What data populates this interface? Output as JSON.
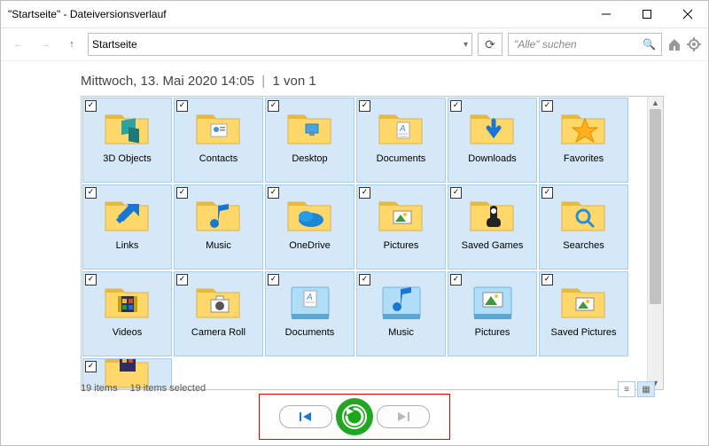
{
  "window": {
    "title": "\"Startseite\" - Dateiversionsverlauf"
  },
  "toolbar": {
    "address": "Startseite",
    "search_placeholder": "\"Alle\" suchen"
  },
  "header": {
    "date": "Mittwoch, 13. Mai 2020 14:05",
    "position": "1 von 1"
  },
  "items": [
    {
      "label": "3D Objects",
      "icon": "folder-3d"
    },
    {
      "label": "Contacts",
      "icon": "folder-contacts"
    },
    {
      "label": "Desktop",
      "icon": "folder-desktop"
    },
    {
      "label": "Documents",
      "icon": "folder-documents"
    },
    {
      "label": "Downloads",
      "icon": "folder-downloads"
    },
    {
      "label": "Favorites",
      "icon": "folder-favorites"
    },
    {
      "label": "Links",
      "icon": "folder-links"
    },
    {
      "label": "Music",
      "icon": "folder-music"
    },
    {
      "label": "OneDrive",
      "icon": "folder-onedrive"
    },
    {
      "label": "Pictures",
      "icon": "folder-pictures"
    },
    {
      "label": "Saved Games",
      "icon": "folder-games"
    },
    {
      "label": "Searches",
      "icon": "folder-searches"
    },
    {
      "label": "Videos",
      "icon": "folder-videos"
    },
    {
      "label": "Camera Roll",
      "icon": "folder-camera"
    },
    {
      "label": "Documents",
      "icon": "library-documents"
    },
    {
      "label": "Music",
      "icon": "library-music"
    },
    {
      "label": "Pictures",
      "icon": "library-pictures"
    },
    {
      "label": "Saved Pictures",
      "icon": "folder-saved-pictures"
    }
  ],
  "overflow_item": {
    "icon": "folder-video2"
  },
  "status": {
    "count": "19 items",
    "selected": "19 items selected"
  }
}
